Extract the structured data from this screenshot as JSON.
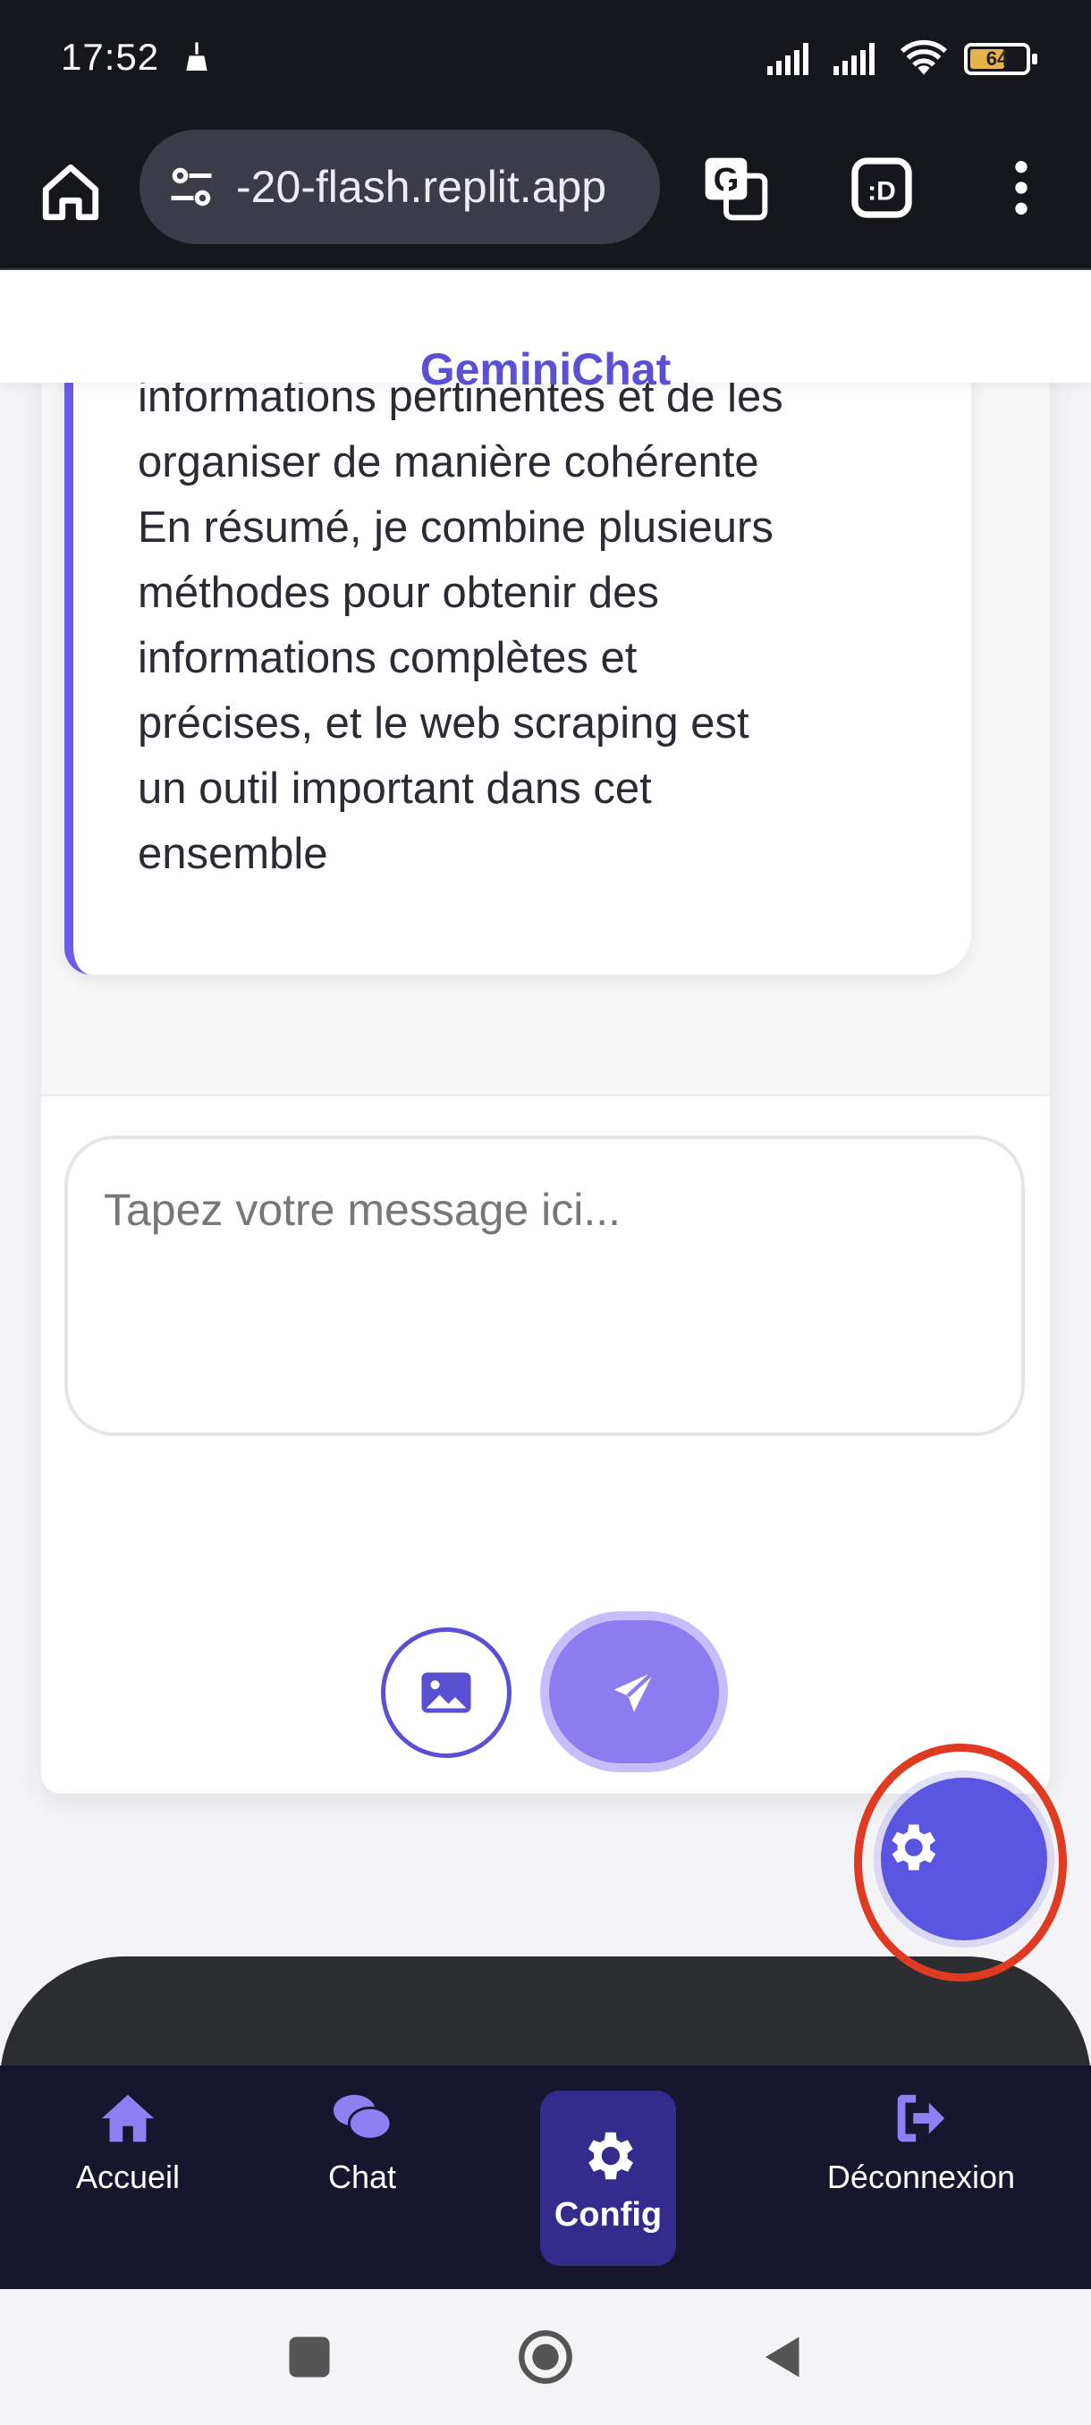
{
  "status_bar": {
    "time": "17:52",
    "battery": "64",
    "battery_level": 0.64
  },
  "browser": {
    "url": "-20-flash.replit.app"
  },
  "app": {
    "title": "GeminiChat"
  },
  "chat": {
    "message_text": "informations pertinentes et de les\norganiser de manière cohérente\nEn résumé, je combine plusieurs\nméthodes pour obtenir des\ninformations complètes et\nprécises, et le web scraping est\nun outil important dans cet\nensemble"
  },
  "composer": {
    "placeholder": "Tapez votre message ici..."
  },
  "nav": {
    "items": [
      {
        "label": "Accueil",
        "icon": "home-icon"
      },
      {
        "label": "Chat",
        "icon": "chat-icon"
      },
      {
        "label": "Config",
        "icon": "gear-icon"
      },
      {
        "label": "Déconnexion",
        "icon": "logout-icon"
      }
    ]
  },
  "colors": {
    "accent": "#5b4fd4",
    "nav_bg": "#17162e",
    "fab": "#5a55e0",
    "highlight_ring": "#e03b22"
  }
}
